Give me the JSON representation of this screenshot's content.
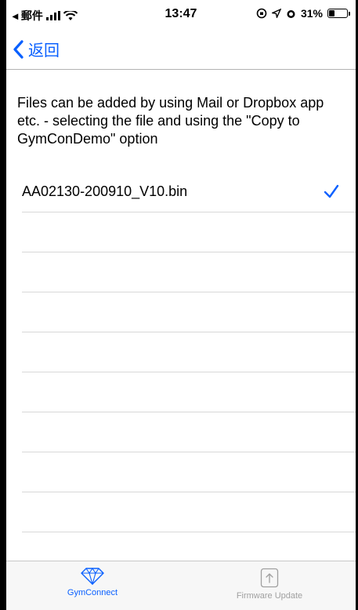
{
  "status_bar": {
    "back_app": "◂ 郵件",
    "time": "13:47",
    "battery_percent": "31%",
    "battery_level": 0.31
  },
  "nav": {
    "back_label": "返回"
  },
  "description": "Files can be added by using Mail or Dropbox app etc. - selecting the file and using the \"Copy to GymConDemo\" option",
  "files": [
    {
      "name": "AA02130-200910_V10.bin",
      "selected": true
    }
  ],
  "tabs": [
    {
      "label": "GymConnect",
      "icon": "diamond-icon",
      "active": true
    },
    {
      "label": "Firmware Update",
      "icon": "upload-icon",
      "active": false
    }
  ],
  "colors": {
    "accent": "#0a60ff",
    "inactive": "#a0a0a0"
  }
}
